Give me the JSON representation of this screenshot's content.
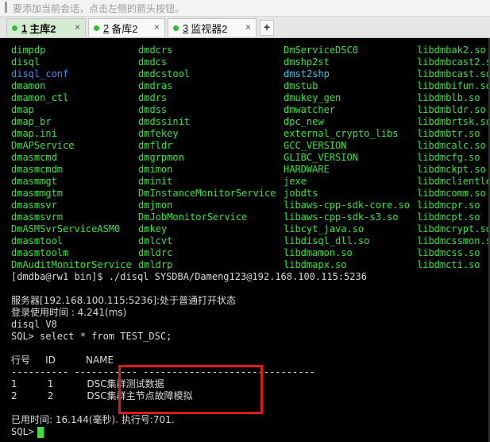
{
  "hint": {
    "text": "要添加当前会话，点击左侧的箭头按钮。"
  },
  "tabs": [
    {
      "num": "1",
      "label": "主库2",
      "close": "×"
    },
    {
      "num": "2",
      "label": "备库2",
      "close": "×"
    },
    {
      "num": "3",
      "label": "监视器2",
      "close": "×"
    }
  ],
  "add_tab": "+",
  "ls_columns": [
    [
      "dimpdp",
      "disql",
      "disql_conf",
      "dmamon",
      "dmamon_ctl",
      "dmap",
      "dmap_br",
      "dmap.ini",
      "DmAPService",
      "dmasmcmd",
      "dmasmcmdm",
      "dmasmmgt",
      "dmasmmgtm",
      "dmasmsvr",
      "dmasmsvrm",
      "DmASMSvrServiceASM0",
      "dmasmtool",
      "dmasmtoolm",
      "DmAuditMonitorService"
    ],
    [
      "dmdcrs",
      "dmdcs",
      "dmdcstool",
      "dmdras",
      "dmdrs",
      "dmdss",
      "dmdssinit",
      "dmfekey",
      "dmfldr",
      "dmgrpmon",
      "dmimon",
      "dminit",
      "DmInstanceMonitorService",
      "dmjmon",
      "DmJobMonitorService",
      "dmkey",
      "dmlcvt",
      "dmldrc",
      "dmldrp"
    ],
    [
      "DmServiceDSC0",
      "dmshp2st",
      "dmst2shp",
      "dmstub",
      "dmukey_gen",
      "dmwatcher",
      "dpc_new",
      "external_crypto_libs",
      "GCC_VERSION",
      "GLIBC_VERSION",
      "HARDWARE",
      "jexe",
      "jobdts",
      "libaws-cpp-sdk-core.so",
      "libaws-cpp-sdk-s3.so",
      "libcyt_java.so",
      "libdisql_dll.so",
      "libdmamon.so",
      "libdmapx.so"
    ],
    [
      "libdmbak2.so",
      "libdmbcast2.so",
      "libdmbcast.so",
      "libdmbifun.so",
      "libdmblb.so",
      "libdmbldr.so",
      "libdmbrtsk.so",
      "libdmbtr.so",
      "libdmcalc.so",
      "libdmcfg.so",
      "libdmckpt.so",
      "libdmclientlex",
      "libdmcomm.so",
      "libdmcpr.so",
      "libdmcpt.so",
      "libdmcrypt.so",
      "libdmcssmon.so",
      "libdmcss.so",
      "libdmcti.so"
    ]
  ],
  "ls_colors": {
    "2": "blue",
    "40": "cyan"
  },
  "terminal": {
    "prompt_cmd": "[dmdba@rw1 bin]$ ./disql SYSDBA/Dameng123@192.168.100.115:5236",
    "blank1": "",
    "server_status": "服务器[192.168.100.115:5236]:处于普通打开状态",
    "login_time": "登录使用时间 : 4.241(ms)",
    "version": "disql V8",
    "query": "SQL> select * from TEST_DSC;",
    "blank2": "",
    "header": "行号     ID          NAME",
    "separator": "---------- ----------- ------------------------------",
    "row1": "1          1           DSC集群测试数据",
    "row2": "2          2           DSC集群主节点故障模拟",
    "blank3": "",
    "elapsed": "已用时间: 16.144(毫秒). 执行号:701.",
    "sql_prompt": "SQL> "
  }
}
